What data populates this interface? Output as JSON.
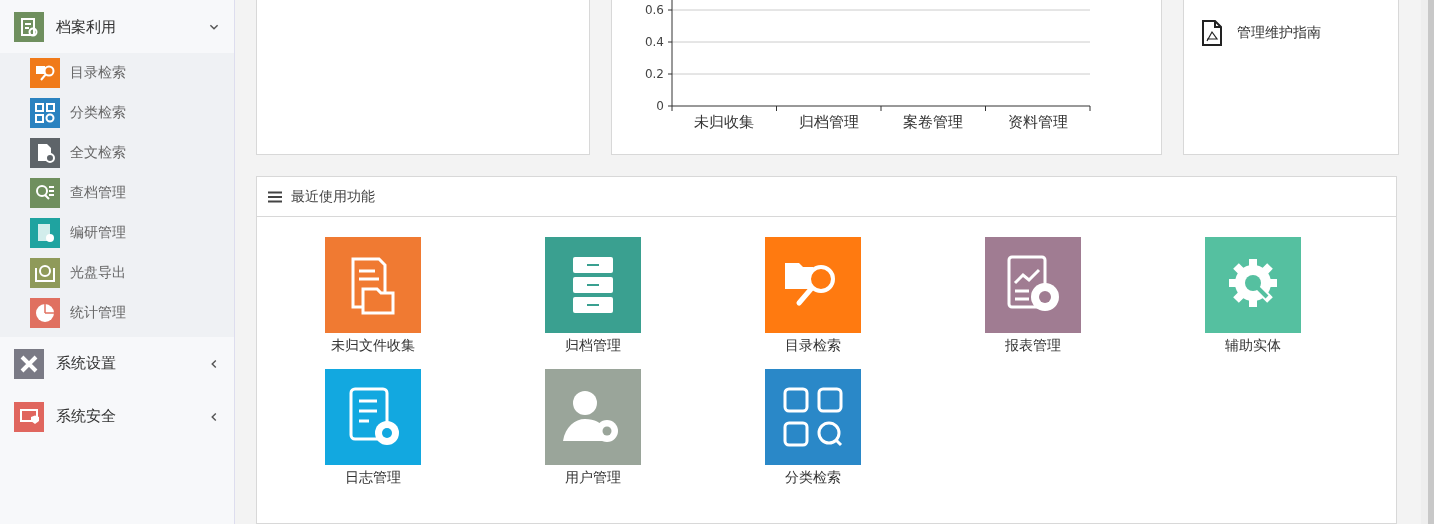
{
  "sidebar": {
    "items": [
      {
        "label": "档案利用",
        "expanded": true,
        "children": [
          {
            "label": "目录检索",
            "color": "#f07a1a"
          },
          {
            "label": "分类检索",
            "color": "#2a82c0"
          },
          {
            "label": "全文检索",
            "color": "#5e6469"
          },
          {
            "label": "查档管理",
            "color": "#6f8f5e"
          },
          {
            "label": "编研管理",
            "color": "#1fa3a0"
          },
          {
            "label": "光盘导出",
            "color": "#8f9a5a"
          },
          {
            "label": "统计管理",
            "color": "#e07060"
          }
        ]
      },
      {
        "label": "系统设置",
        "expanded": false
      },
      {
        "label": "系统安全",
        "expanded": false
      }
    ]
  },
  "chart_panel": {
    "chart_data": {
      "type": "bar",
      "categories": [
        "未归收集",
        "归档管理",
        "案卷管理",
        "资料管理"
      ],
      "values": [
        0,
        0,
        0,
        0
      ],
      "ylim": [
        0,
        0.6
      ],
      "yticks": [
        0,
        0.2,
        0.4,
        0.6
      ]
    }
  },
  "guide_panel": {
    "documents": [
      "管理维护指南"
    ]
  },
  "recent": {
    "title": "最近使用功能",
    "tiles": [
      {
        "label": "未归文件收集",
        "color": "#f07a32"
      },
      {
        "label": "归档管理",
        "color": "#3aa090"
      },
      {
        "label": "目录检索",
        "color": "#ff7a10"
      },
      {
        "label": "报表管理",
        "color": "#a07c92"
      },
      {
        "label": "辅助实体",
        "color": "#55c0a0"
      },
      {
        "label": "日志管理",
        "color": "#12a8e0"
      },
      {
        "label": "用户管理",
        "color": "#9aa59a"
      },
      {
        "label": "分类检索",
        "color": "#2a88c8"
      }
    ]
  }
}
